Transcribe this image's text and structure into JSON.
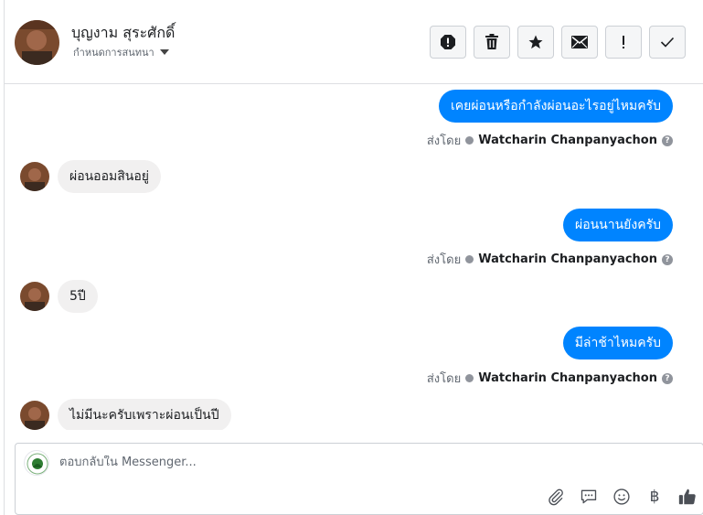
{
  "header": {
    "contact_name": "บุญงาม สุระศักดิ์",
    "subtitle": "กำหนดการสนทนา",
    "toolbar": [
      {
        "name": "spam-button",
        "icon": "alert-icon"
      },
      {
        "name": "delete-button",
        "icon": "trash-icon"
      },
      {
        "name": "star-button",
        "icon": "star-icon"
      },
      {
        "name": "mark-unread-button",
        "icon": "envelope-icon"
      },
      {
        "name": "follow-up-button",
        "icon": "exclamation-icon"
      },
      {
        "name": "mark-done-button",
        "icon": "checkmark-icon"
      }
    ]
  },
  "messages": [
    {
      "direction": "out",
      "text": "เคยผ่อนหรือกำลังผ่อนอะไรอยู่ไหมครับ",
      "sent_by_label": "ส่งโดย",
      "sender": "Watcharin Chanpanyachon"
    },
    {
      "direction": "in",
      "text": "ผ่อนออมสินอยู่"
    },
    {
      "direction": "out",
      "text": "ผ่อนนานยังครับ",
      "sent_by_label": "ส่งโดย",
      "sender": "Watcharin Chanpanyachon"
    },
    {
      "direction": "in",
      "text": "5ปี"
    },
    {
      "direction": "out",
      "text": "มีล่าช้าไหมครับ",
      "sent_by_label": "ส่งโดย",
      "sender": "Watcharin Chanpanyachon"
    },
    {
      "direction": "in",
      "text": "ไม่มีนะครับเพราะผ่อนเป็นปี"
    }
  ],
  "composer": {
    "placeholder": "ตอบกลับใน Messenger...",
    "currency_symbol": "฿",
    "tools": [
      "paperclip-icon",
      "saved-reply-icon",
      "emoji-icon",
      "currency-icon",
      "thumbs-up-icon"
    ]
  },
  "colors": {
    "outgoing_bubble": "#0084ff",
    "incoming_bubble": "#f1f0f0",
    "border": "#dddfe2"
  }
}
